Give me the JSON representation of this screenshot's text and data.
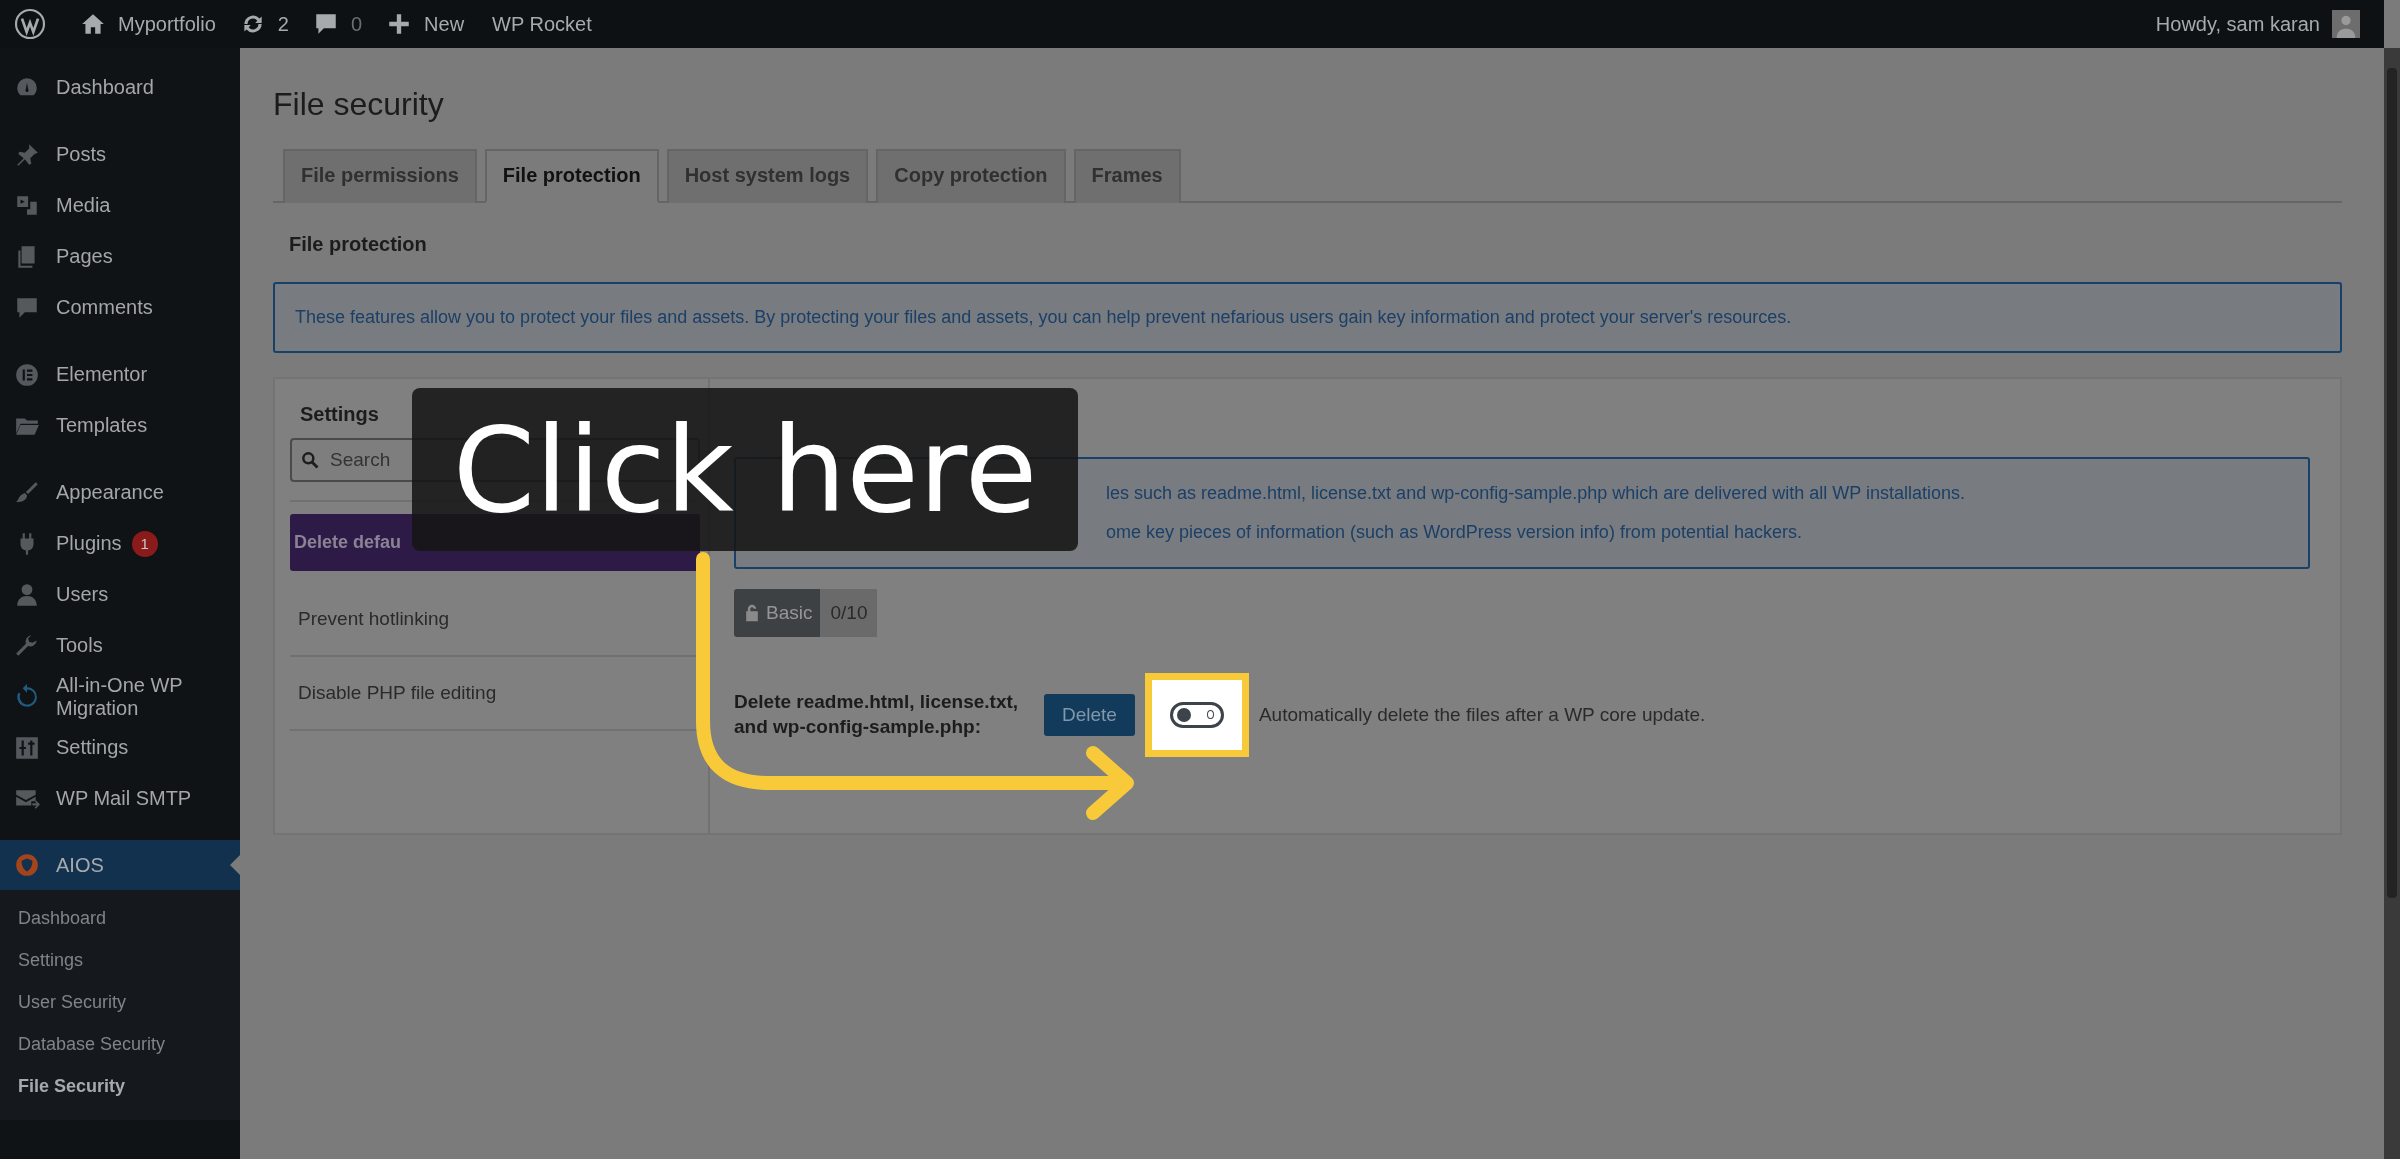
{
  "admin_bar": {
    "site": "Myportfolio",
    "updates": "2",
    "comments": "0",
    "new": "New",
    "plugin_link": "WP Rocket",
    "greeting": "Howdy, sam karan"
  },
  "sidebar": {
    "groups": [
      [
        {
          "label": "Dashboard",
          "selected": false
        }
      ],
      [
        {
          "label": "Posts",
          "selected": false
        },
        {
          "label": "Media",
          "selected": false
        },
        {
          "label": "Pages",
          "selected": false
        },
        {
          "label": "Comments",
          "selected": false
        }
      ],
      [
        {
          "label": "Elementor",
          "selected": false
        },
        {
          "label": "Templates",
          "selected": false
        }
      ],
      [
        {
          "label": "Appearance",
          "selected": false
        },
        {
          "label": "Plugins",
          "selected": false,
          "badge": "1"
        },
        {
          "label": "Users",
          "selected": false
        },
        {
          "label": "Tools",
          "selected": false
        },
        {
          "label": "All-in-One WP Migration",
          "selected": false
        },
        {
          "label": "Settings",
          "selected": false
        },
        {
          "label": "WP Mail SMTP",
          "selected": false
        }
      ],
      [
        {
          "label": "AIOS",
          "selected": true
        }
      ]
    ],
    "submenu": [
      {
        "label": "Dashboard",
        "selected": false
      },
      {
        "label": "Settings",
        "selected": false
      },
      {
        "label": "User Security",
        "selected": false
      },
      {
        "label": "Database Security",
        "selected": false
      },
      {
        "label": "File Security",
        "selected": true
      }
    ]
  },
  "page": {
    "title": "File security",
    "tabs": [
      {
        "label": "File permissions",
        "selected": false
      },
      {
        "label": "File protection",
        "selected": true
      },
      {
        "label": "Host system logs",
        "selected": false
      },
      {
        "label": "Copy protection",
        "selected": false
      },
      {
        "label": "Frames",
        "selected": false
      }
    ],
    "section_title": "File protection",
    "notice": "These features allow you to protect your files and assets. By protecting your files and assets, you can help prevent nefarious users gain key information and protect your server's resources.",
    "settings": {
      "title": "Settings",
      "search": {
        "placeholder": "Search"
      },
      "items": [
        {
          "label": "Delete defau",
          "selected": true
        },
        {
          "label": "Prevent hotlinking",
          "selected": false
        },
        {
          "label": "Disable PHP file editing",
          "selected": false
        }
      ]
    },
    "feature": {
      "info": [
        "les such as readme.html, license.txt and wp-config-sample.php which are delivered with all WP installations.",
        "ome key pieces of information (such as WordPress version info) from potential hackers."
      ],
      "badge": {
        "level": "Basic",
        "score": "0/10"
      },
      "action_label": "Delete readme.html, license.txt, and wp-config-sample.php:",
      "action_button": "Delete",
      "toggle": {
        "checked": false,
        "label": "Automatically delete the files after a WP core update."
      }
    }
  },
  "callout": {
    "text": "Click here"
  }
}
